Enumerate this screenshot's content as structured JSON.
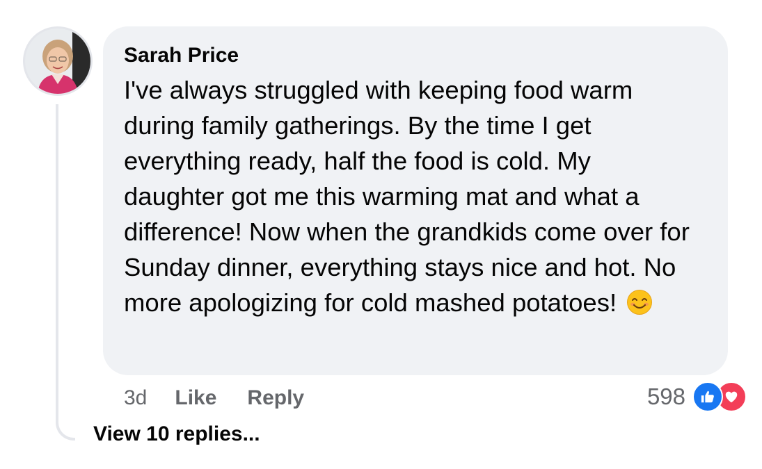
{
  "comment": {
    "author": "Sarah Price",
    "text": "I've always struggled with keeping food warm during family gatherings. By the time I get everything ready, half the food is cold. My daughter got me this warming mat and what a difference! Now when the grandkids come over for Sunday dinner, everything stays nice and hot. No more apologizing for cold mashed potatoes!",
    "emoji": "smiling-face-with-smiling-eyes"
  },
  "actions": {
    "time": "3d",
    "like_label": "Like",
    "reply_label": "Reply"
  },
  "reactions": {
    "count": "598",
    "types": [
      "like",
      "love"
    ]
  },
  "replies": {
    "view_label": "View 10 replies..."
  },
  "icons": {
    "like": "thumbs-up-icon",
    "love": "heart-icon"
  },
  "colors": {
    "bubble_bg": "#f0f2f5",
    "secondary_text": "#65676b",
    "like_blue": "#1877f2",
    "love_red": "#f33e58"
  }
}
